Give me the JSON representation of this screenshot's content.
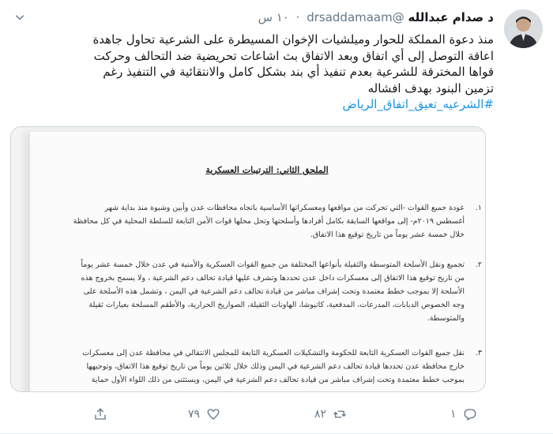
{
  "tweet": {
    "name": "د صدام عبدالله",
    "handle": "@drsaddamaam",
    "separator": "·",
    "time": "١٠ س",
    "text_lines": [
      "منذ دعوة المملكة للحوار وميلشيات الإخوان المسيطرة على الشرعية تحاول جاهدة",
      "اعاقة التوصل إلى أي اتفاق وبعد الاتفاق بث اشاعات تحريضية ضد التحالف وحركت",
      "قواها المخترقة للشرعية بعدم تنفيذ أي بند بشكل كامل والانتقائية في التنفيذ رغم",
      "تزمين البنود بهدف افشاله"
    ],
    "hashtag": "#الشرعيه_تعيق_اتفاق_الرياض"
  },
  "document": {
    "title": "الملحق الثاني: الترتيبات العسكرية",
    "items": [
      {
        "num": "١.",
        "lines": [
          "عودة جميع القوات -التي تحركت من مواقعها ومعسكراتها الأساسية باتجاه محافظات عدن وأبين وشبوة منذ بداية شهر",
          "أغسطس ٢٠١٩م- إلى مواقعها السابقة بكامل أفرادها وأسلحتها وتحل محلها قوات الأمن التابعة للسلطة المحلية في كل محافظة",
          "خلال خمسة عشر يوماً من تاريخ توقيع هذا الاتفاق."
        ]
      },
      {
        "num": "٢.",
        "lines": [
          "تجميع ونقل الأسلحة المتوسطة والثقيلة بأنواعها المختلفة من جميع القوات العسكرية والأمنية في عدن خلال خمسة عشر يوماً",
          "من تاريخ توقيع هذا الاتفاق إلى معسكرات داخل عدن تحددها وتشرف عليها قيادة تحالف دعم الشرعية ، ولا يسمح بخروج هذه",
          "الأسلحة إلا بموجب خطط معتمدة وتحت إشراف مباشر من قيادة تحالف دعم الشرعية في اليمن ، وتشمل هذه الأسلحة على",
          "وجه الخصوص الدبابات، المدرعات، المدفعية، كاتيوشا، الهاونات الثقيلة، الصواريخ الحرارية، والأطقم المسلحة بعيارات ثقيلة",
          "والمتوسطة."
        ]
      },
      {
        "num": "٣.",
        "lines": [
          "نقل جميع القوات العسكرية التابعة للحكومة والتشكيلات العسكرية التابعة للمجلس الانتقالي في محافظة عدن إلى معسكرات",
          "خارج محافظة عدن تحددها قيادة تحالف دعم الشرعية في اليمن وذلك خلال ثلاثين يوماً من تاريخ توقيع هذا الاتفاق، وتوجيهها",
          "بموجب خطط معتمدة وتحت إشراف مباشر من قيادة تحالف دعم الشرعية في اليمن، ويستثنى من ذلك اللواء الأول حماية"
        ]
      }
    ]
  },
  "actions": {
    "replies": "١",
    "retweets": "٨٢",
    "likes": "٧٩"
  },
  "colors": {
    "link": "#1b95e0",
    "muted": "#657786"
  }
}
